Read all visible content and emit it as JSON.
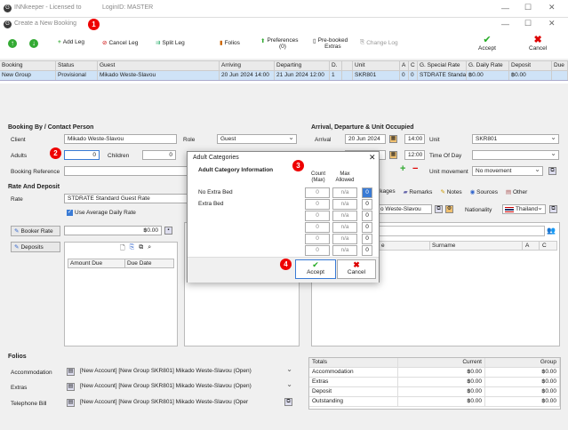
{
  "app": {
    "title": "INNkeeper - Licensed to",
    "login": "LoginID: MASTER",
    "dialog_title": "Create a New Booking"
  },
  "badges": [
    "1",
    "2",
    "3",
    "4"
  ],
  "toolbar": {
    "add_leg": "Add Leg",
    "cancel_leg": "Cancel Leg",
    "split_leg": "Split Leg",
    "folios": "Folios",
    "preferences": "Preferences",
    "pref_count": "(0)",
    "prebooked": "Pre-booked",
    "extras": "Extras",
    "change_log": "Change Log",
    "accept": "Accept",
    "cancel": "Cancel"
  },
  "grid": {
    "headers": [
      "Booking",
      "Status",
      "Guest",
      "Arriving",
      "Departing",
      "D.",
      "",
      "Unit",
      "A",
      "C",
      "G. Special Rate",
      "G. Daily Rate",
      "Deposit",
      "Due"
    ],
    "row": [
      "New Group",
      "Provisional",
      "Mikado Weste-Slavou",
      "20 Jun 2024 14:00",
      "21 Jun 2024 12:00",
      "1",
      "",
      "SKR801",
      "0",
      "0",
      "STDRATE Standar",
      "฿0.00",
      "฿0.00",
      ""
    ]
  },
  "booking": {
    "section": "Booking By / Contact Person",
    "client_label": "Client",
    "client": "Mikado Weste-Slavou",
    "role_label": "Role",
    "role": "Guest",
    "adults_label": "Adults",
    "adults": "0",
    "children_label": "Children",
    "children": "0",
    "bookref_label": "Booking Reference"
  },
  "rate": {
    "section": "Rate And Deposit",
    "rate_label": "Rate",
    "rate": "STDRATE Standard Guest Rate",
    "use_avg": "Use Average Daily Rate",
    "booker_rate": "Booker Rate",
    "booker_value": "฿0.00",
    "deposits": "Deposits",
    "col_amount": "Amount Due",
    "col_date": "Due Date"
  },
  "arrival": {
    "section": "Arrival, Departure & Unit Occupied",
    "arrival_label": "Arrival",
    "arrival_date": "20 Jun 2024",
    "arrival_time": "14:00",
    "unit_label": "Unit",
    "unit": "SKR801",
    "dep_time": "12:00",
    "timeofday": "Time Of Day",
    "unit_movement": "Unit movement",
    "no_movement": "No movement"
  },
  "tabs": {
    "packages": "ckages",
    "remarks": "Remarks",
    "notes": "Notes",
    "sources": "Sources",
    "other": "Other",
    "guest": "o Weste-Slavou",
    "nationality_label": "Nationality",
    "nationality": "Thailand",
    "col_e": "e",
    "col_surname": "Surname",
    "col_a": "A",
    "col_c": "C"
  },
  "folios": {
    "section": "Folios",
    "accommodation_label": "Accommodation",
    "accommodation": "[New Account] [New Group SKR801] Mikado Weste-Slavou (Open)",
    "extras_label": "Extras",
    "extras": "[New Account] [New Group SKR801] Mikado Weste-Slavou (Open)",
    "telephone_label": "Telephone Bill",
    "telephone": "[New Account] [New Group SKR801] Mikado Weste-Slavou (Oper"
  },
  "totals": {
    "headers": [
      "Totals",
      "Current",
      "Group"
    ],
    "rows": [
      [
        "Accommodation",
        "฿0.00",
        "฿0.00"
      ],
      [
        "Extras",
        "฿0.00",
        "฿0.00"
      ],
      [
        "Deposit",
        "฿0.00",
        "฿0.00"
      ],
      [
        "Outstanding",
        "฿0.00",
        "฿0.00"
      ]
    ]
  },
  "dialog": {
    "title": "Adult Categories",
    "heading": "Adult Category Information",
    "col_count": "Count",
    "col_count2": "(Max)",
    "col_max": "Max",
    "col_max2": "Allowed",
    "rows": [
      {
        "label": "No Extra Bed",
        "count": "0",
        "max": "n/a",
        "val": "0"
      },
      {
        "label": "Extra Bed",
        "count": "0",
        "max": "n/a",
        "val": "0"
      },
      {
        "label": "",
        "count": "0",
        "max": "n/a",
        "val": "0"
      },
      {
        "label": "",
        "count": "0",
        "max": "n/a",
        "val": "0"
      },
      {
        "label": "",
        "count": "0",
        "max": "n/a",
        "val": "0"
      },
      {
        "label": "",
        "count": "0",
        "max": "n/a",
        "val": "0"
      }
    ],
    "accept": "Accept",
    "cancel": "Cancel"
  }
}
